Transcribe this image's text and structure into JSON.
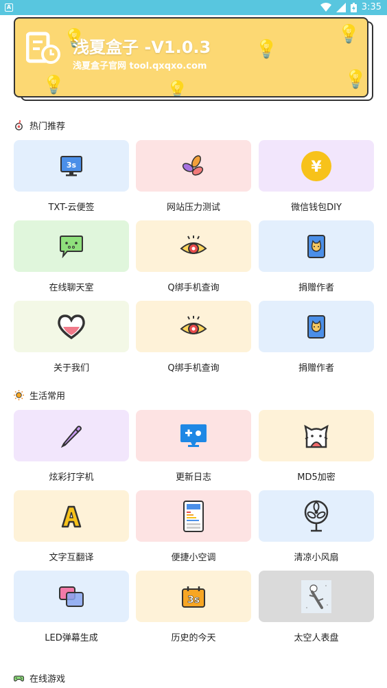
{
  "status_bar": {
    "time": "3:35",
    "app_badge": "A"
  },
  "banner": {
    "title": "浅夏盒子 -V1.0.3",
    "subtitle": "浅夏盒子官网 tool.qxqxo.com"
  },
  "sections": {
    "hot": {
      "title": "热门推荐",
      "items": [
        {
          "label": "TXT-云便签",
          "icon": "monitor-3s-icon",
          "color": "#e3effd"
        },
        {
          "label": "网站压力测试",
          "icon": "pinwheel-icon",
          "color": "#fde3e3"
        },
        {
          "label": "微信钱包DIY",
          "icon": "yen-coin-icon",
          "color": "#f2e6fc"
        },
        {
          "label": "在线聊天室",
          "icon": "chat-bubble-icon",
          "color": "#e0f6dc"
        },
        {
          "label": "Q绑手机查询",
          "icon": "eye-icon",
          "color": "#fef2d8"
        },
        {
          "label": "捐赠作者",
          "icon": "phone-cat-icon",
          "color": "#e3effd"
        },
        {
          "label": "关于我们",
          "icon": "heart-icon",
          "color": "#f3f8e6"
        },
        {
          "label": "Q绑手机查询",
          "icon": "eye-icon",
          "color": "#fef2d8"
        },
        {
          "label": "捐赠作者",
          "icon": "phone-cat-icon",
          "color": "#e3effd"
        }
      ]
    },
    "life": {
      "title": "生活常用",
      "items": [
        {
          "label": "炫彩打字机",
          "icon": "pencil-icon",
          "color": "#f2e6fc"
        },
        {
          "label": "更新日志",
          "icon": "screen-icon",
          "color": "#fde3e3"
        },
        {
          "label": "MD5加密",
          "icon": "ghost-cat-icon",
          "color": "#fef2d8"
        },
        {
          "label": "文字互翻译",
          "icon": "letter-a-icon",
          "color": "#fef2d8"
        },
        {
          "label": "便捷小空调",
          "icon": "air-conditioner-icon",
          "color": "#fde3e3"
        },
        {
          "label": "清凉小风扇",
          "icon": "fan-icon",
          "color": "#e3effd"
        },
        {
          "label": "LED弹幕生成",
          "icon": "overlap-squares-icon",
          "color": "#e3effd"
        },
        {
          "label": "历史的今天",
          "icon": "calendar-3s-icon",
          "color": "#fef2d8"
        },
        {
          "label": "太空人表盘",
          "icon": "astronaut-icon",
          "color": "#dadada"
        }
      ]
    },
    "games": {
      "title": "在线游戏"
    }
  }
}
